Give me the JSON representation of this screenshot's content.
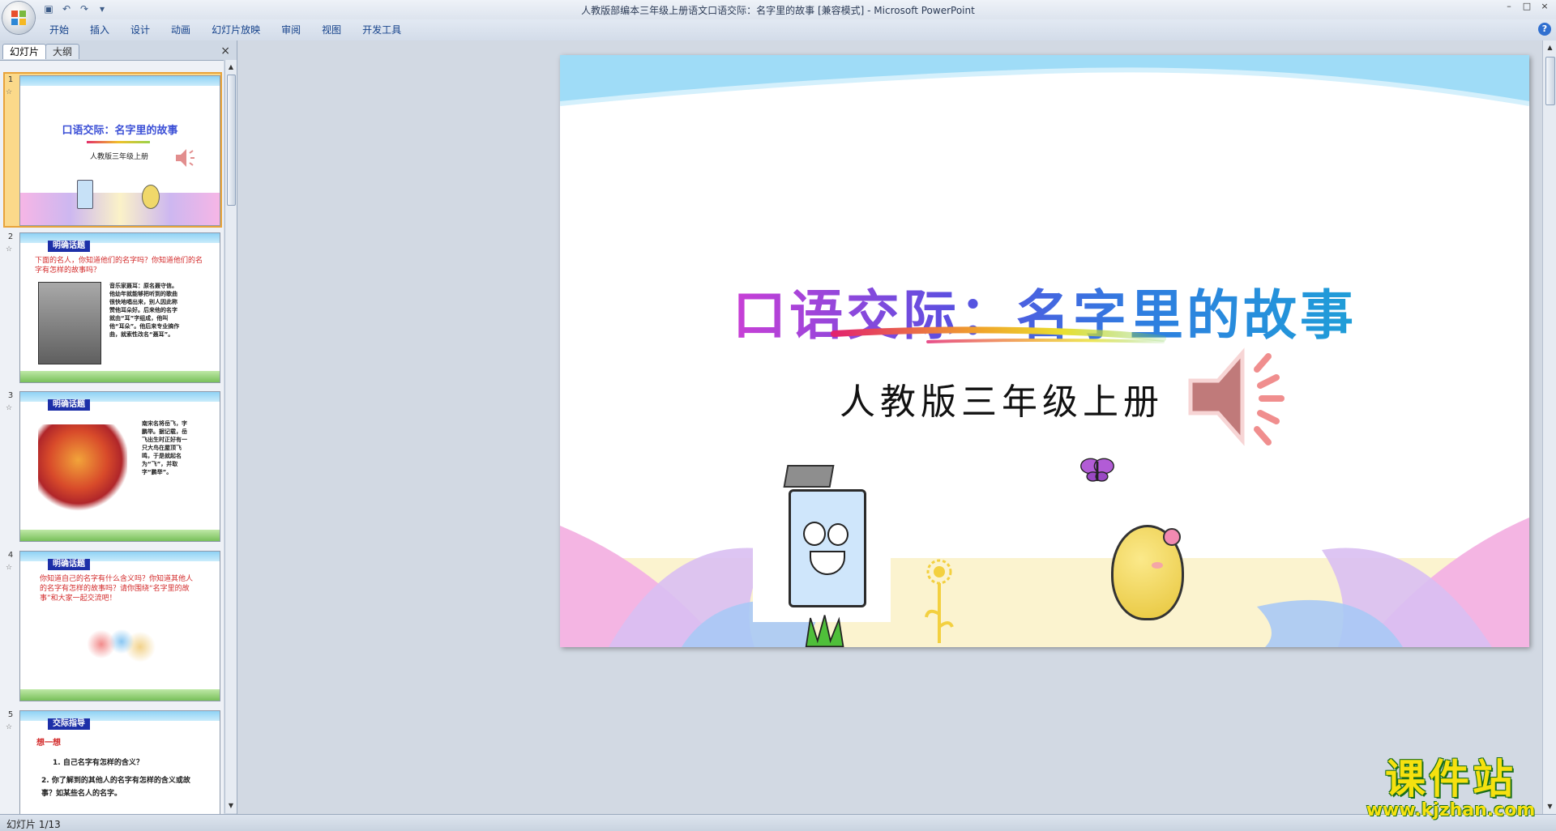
{
  "window": {
    "title": "人教版部编本三年级上册语文口语交际：名字里的故事 [兼容模式] - Microsoft PowerPoint",
    "minimize": "–",
    "maximize": "□",
    "close": "×"
  },
  "ribbon": {
    "tabs": [
      "开始",
      "插入",
      "设计",
      "动画",
      "幻灯片放映",
      "审阅",
      "视图",
      "开发工具"
    ],
    "help": "?"
  },
  "left_pane": {
    "tab_slides": "幻灯片",
    "tab_outline": "大纲",
    "close": "×"
  },
  "thumbnails": [
    {
      "num": "1",
      "title": "口语交际：名字里的故事",
      "subtitle": "人教版三年级上册"
    },
    {
      "num": "2",
      "label": "明确话题",
      "question": "下面的名人，你知道他们的名字吗？你知道他们的名字有怎样的故事吗？",
      "caption": "音乐家聂耳：原名聂守信。他幼年就能够把听到的歌曲很快地唱出来，别人因此称赞他耳朵好。后来他的名字就由“耳”字组成，他叫他“耳朵”。他后来专业搞作曲，就索性改名“聂耳”。"
    },
    {
      "num": "3",
      "label": "明确话题",
      "caption": "南宋名将岳飞，字鹏举。据记载，岳飞出生时正好有一只大鸟在屋顶飞鸣，于是就起名为“飞”，并取字“鹏举”。"
    },
    {
      "num": "4",
      "label": "明确话题",
      "question": "你知道自己的名字有什么含义吗？你知道其他人的名字有怎样的故事吗？请你围绕“名字里的故事”和大家一起交流吧！"
    },
    {
      "num": "5",
      "label": "交际指导",
      "heading": "想一想",
      "item1": "1. 自己名字有怎样的含义？",
      "item2": "2. 你了解到的其他人的名字有怎样的含义或故事？如某些名人的名字。"
    }
  ],
  "slide": {
    "title": "口语交际：名字里的故事",
    "subtitle": "人教版三年级上册"
  },
  "status": {
    "slide_indicator": "幻灯片 1/13"
  },
  "watermark": {
    "line1": "课件站",
    "line2": "www.kjzhan.com"
  },
  "colors": {
    "title_gradient": [
      "#c93fd6",
      "#5b4fe0",
      "#2f7de0",
      "#1f9ed8"
    ],
    "accent_selected": "#e8a33a",
    "top_wave": "#9fdcf7"
  },
  "icons": [
    "office-logo-icon",
    "save-icon",
    "undo-icon",
    "redo-icon",
    "speaker-icon",
    "butterfly-icon",
    "sunflower-icon"
  ]
}
